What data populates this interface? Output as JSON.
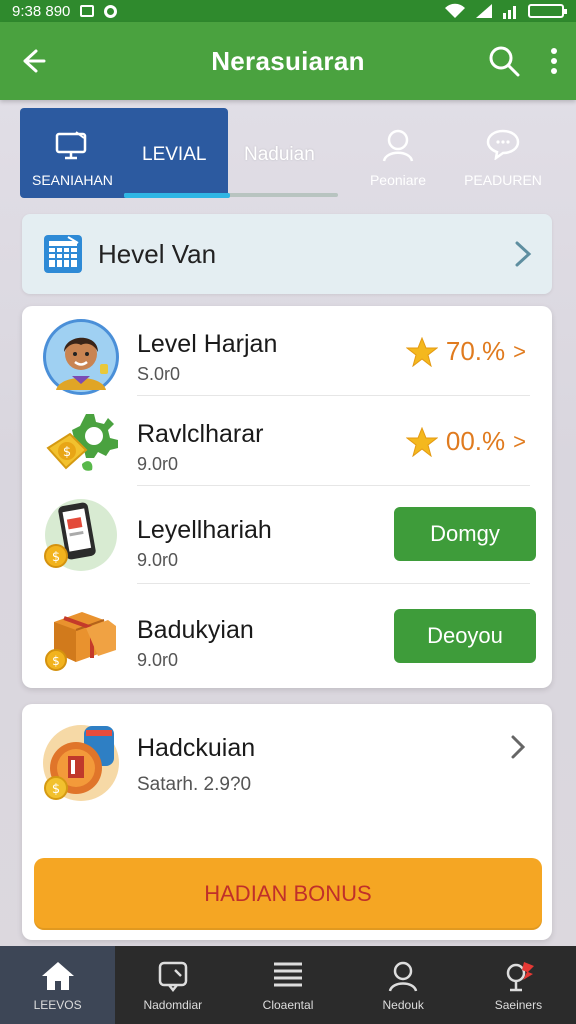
{
  "status_bar": {
    "time": "9:38 890"
  },
  "app_bar": {
    "title": "Nerasuiaran"
  },
  "tabs": [
    {
      "label_big": "LEVIAL",
      "label_small": "SEANIAHAN"
    },
    {
      "label": "Naduian"
    },
    {
      "label": "Peoniare"
    },
    {
      "label": "PEADUREN"
    }
  ],
  "header_card": {
    "title": "Hevel Van"
  },
  "list": [
    {
      "name": "Level Harjan",
      "sub": "S.0r0",
      "reward": "70.%"
    },
    {
      "name": "Ravlclharar",
      "sub": "9.0r0",
      "reward": "00.%"
    },
    {
      "name": "Leyellhariah",
      "sub": "9.0r0",
      "button": "Domgy"
    },
    {
      "name": "Badukyian",
      "sub": "9.0r0",
      "button": "Deoyou"
    }
  ],
  "bottom_card": {
    "name": "Hadckuian",
    "sub": "Satarh. 2.9?0",
    "button": "HADIAN BONUS"
  },
  "bottom_nav": [
    {
      "label": "LEEVOS"
    },
    {
      "label": "Nadomdiar"
    },
    {
      "label": "Cloaental"
    },
    {
      "label": "Nedouk"
    },
    {
      "label": "Saeiners"
    }
  ],
  "colors": {
    "app_bar": "#4aa23f",
    "status_bar": "#2f8a2d",
    "active_tab": "#2c5aa0",
    "reward_orange": "#e07b1f",
    "green_button": "#3e9c3a",
    "bonus_button": "#f5a623",
    "bottom_nav": "#2b2b2b"
  }
}
